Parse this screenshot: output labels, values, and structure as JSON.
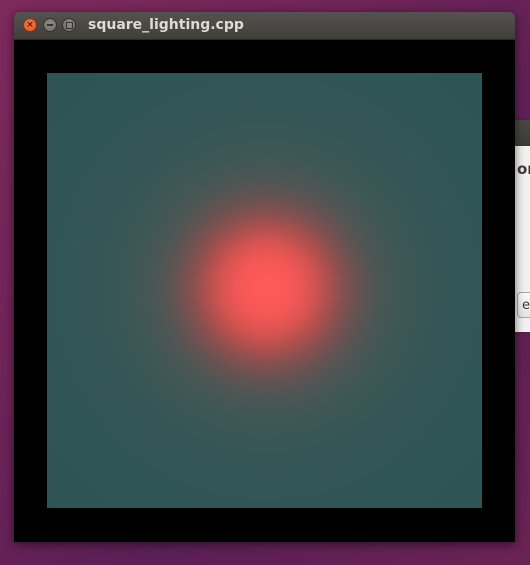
{
  "window": {
    "title": "square_lighting.cpp",
    "buttons": {
      "close_icon": "close-icon",
      "minimize_icon": "minimize-icon",
      "maximize_icon": "maximize-icon"
    }
  },
  "canvas": {
    "border_color": "#000000",
    "surface_color": "#2f5555",
    "light_color": "#ff5959"
  },
  "background_window": {
    "text_fragment": "or.",
    "button_fragment": "e"
  },
  "colors": {
    "desktop": "#6e2458",
    "titlebar": "#3f3e3a",
    "close_button": "#e0531f",
    "title_text": "#dfdbd2"
  }
}
